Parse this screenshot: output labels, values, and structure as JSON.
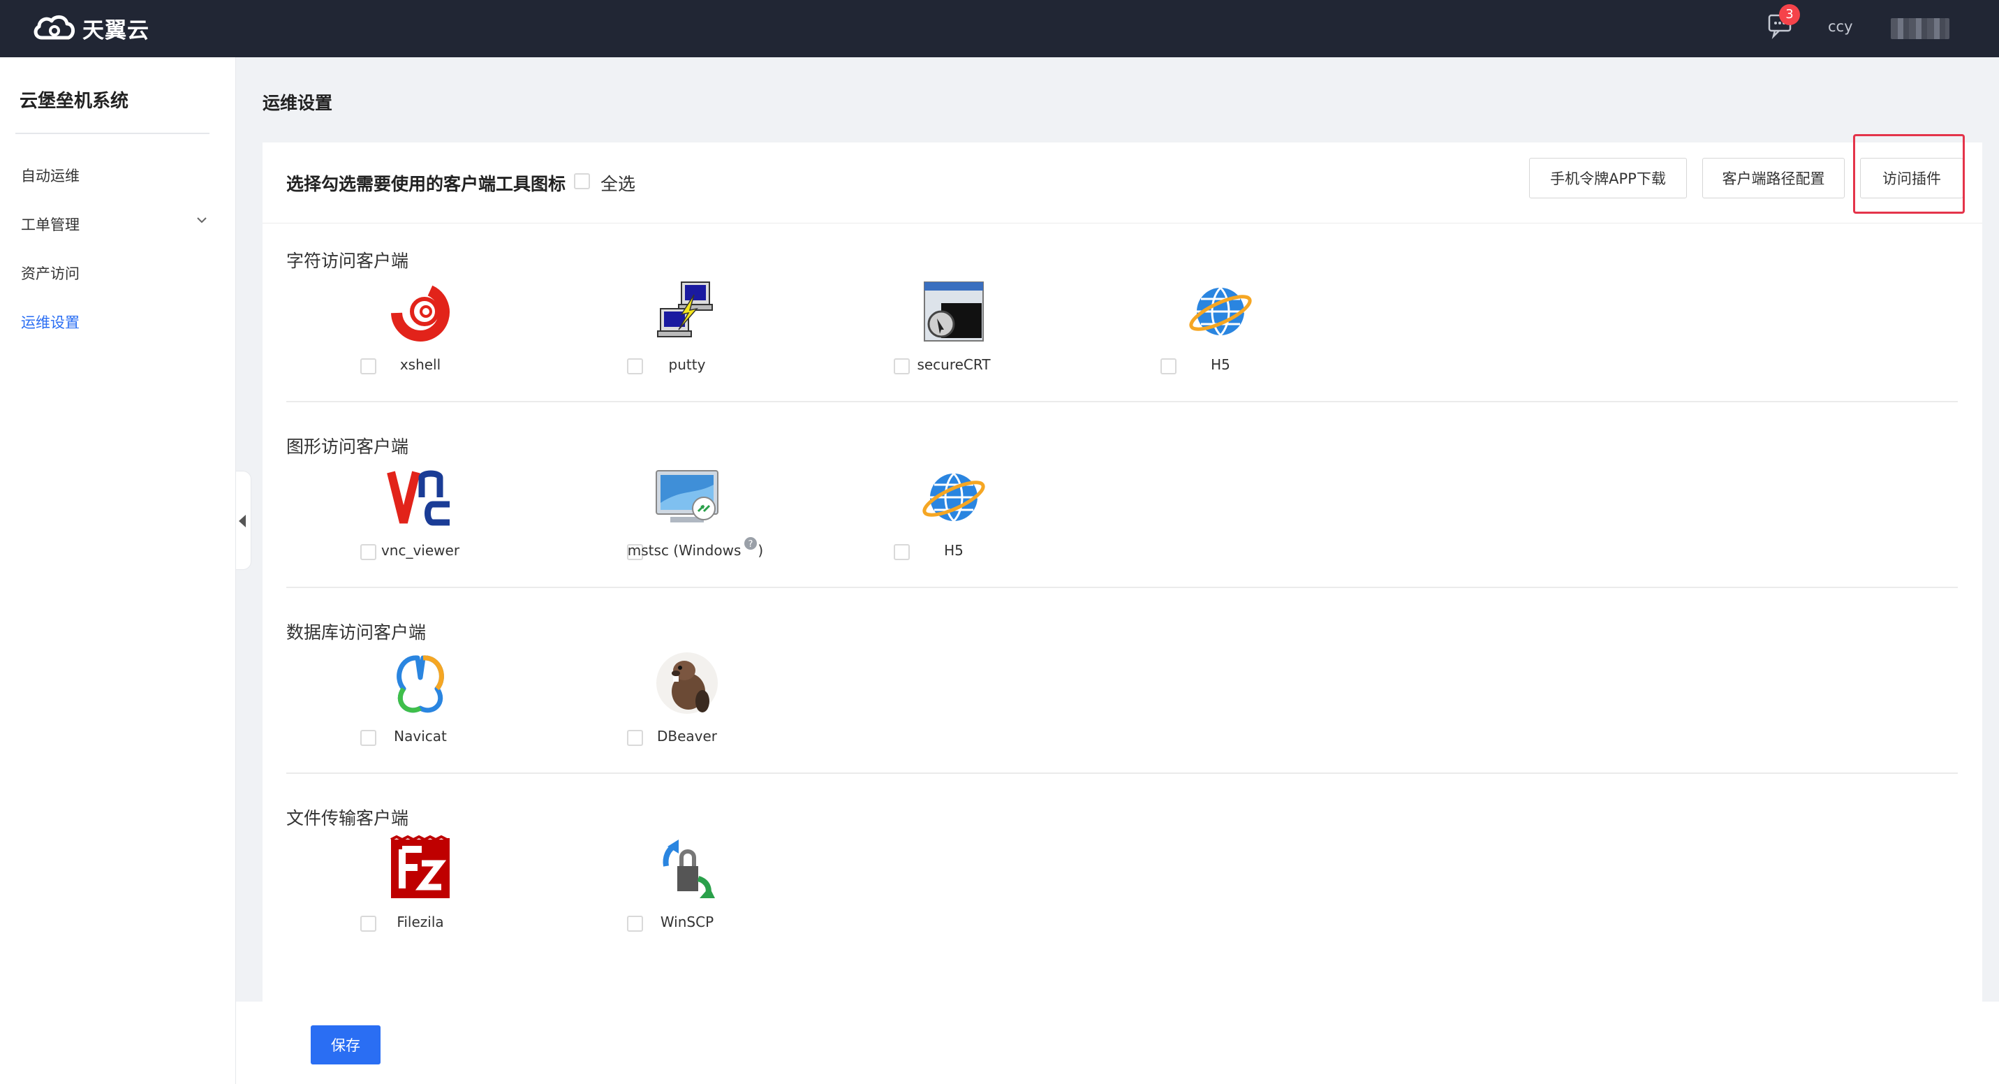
{
  "header": {
    "logo_text": "天翼云",
    "notification_count": "3",
    "username": "ccy"
  },
  "sidebar": {
    "title": "云堡垒机系统",
    "items": [
      {
        "label": "自动运维"
      },
      {
        "label": "工单管理"
      },
      {
        "label": "资产访问"
      },
      {
        "label": "运维设置",
        "active": true
      }
    ]
  },
  "page": {
    "title": "运维设置",
    "instruction": "选择勾选需要使用的客户端工具图标",
    "select_all": "全选",
    "buttons": {
      "app_download": "手机令牌APP下载",
      "client_path": "客户端路径配置",
      "plugin": "访问插件"
    },
    "save": "保存"
  },
  "sections": [
    {
      "title": "字符访问客户端",
      "clients": [
        {
          "name": "xshell",
          "icon": "xshell-icon"
        },
        {
          "name": "putty",
          "icon": "putty-icon"
        },
        {
          "name": "secureCRT",
          "icon": "securecrt-icon"
        },
        {
          "name": "H5",
          "icon": "globe-icon"
        }
      ]
    },
    {
      "title": "图形访问客户端",
      "clients": [
        {
          "name": "vnc_viewer",
          "icon": "vnc-icon"
        },
        {
          "name": "mstsc (Windows",
          "suffix": ")",
          "icon": "mstsc-icon"
        },
        {
          "name": "H5",
          "icon": "globe-icon"
        }
      ]
    },
    {
      "title": "数据库访问客户端",
      "clients": [
        {
          "name": "Navicat",
          "icon": "navicat-icon"
        },
        {
          "name": "DBeaver",
          "icon": "dbeaver-icon"
        }
      ]
    },
    {
      "title": "文件传输客户端",
      "clients": [
        {
          "name": "Filezila",
          "icon": "filezilla-icon"
        },
        {
          "name": "WinSCP",
          "icon": "winscp-icon"
        }
      ]
    }
  ],
  "colors": {
    "topbar": "#212634",
    "accent": "#2a6ef3",
    "highlight": "#e4344a"
  }
}
